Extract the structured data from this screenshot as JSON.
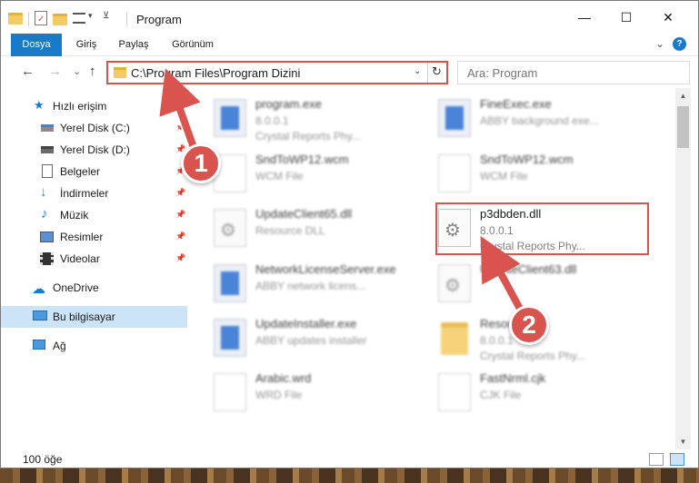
{
  "window": {
    "title": "Program"
  },
  "window_controls": {
    "minimize": "—",
    "maximize": "☐",
    "close": "✕"
  },
  "ribbon": {
    "tabs": [
      "Dosya",
      "Giriş",
      "Paylaş",
      "Görünüm"
    ],
    "expand": "⌄",
    "help": "?"
  },
  "nav": {
    "back": "←",
    "forward": "→",
    "recent": "⌄",
    "up": "↑"
  },
  "address": {
    "path": "C:\\Program Files\\Program Dizini",
    "dropdown": "⌄",
    "refresh": "↻"
  },
  "search": {
    "placeholder": "Ara: Program"
  },
  "sidebar": {
    "quick_access": "Hızlı erişim",
    "items": [
      {
        "label": "Yerel Disk (C:)",
        "icon": "drive-icon",
        "pinned": true
      },
      {
        "label": "Yerel Disk (D:)",
        "icon": "drive-icon",
        "pinned": true
      },
      {
        "label": "Belgeler",
        "icon": "documents-icon",
        "pinned": true
      },
      {
        "label": "İndirmeler",
        "icon": "download-icon",
        "pinned": true
      },
      {
        "label": "Müzik",
        "icon": "music-icon",
        "pinned": true
      },
      {
        "label": "Resimler",
        "icon": "pictures-icon",
        "pinned": true
      },
      {
        "label": "Videolar",
        "icon": "videos-icon",
        "pinned": true
      }
    ],
    "onedrive": "OneDrive",
    "this_pc": "Bu bilgisayar",
    "network": "Ağ",
    "pin_glyph": "📌"
  },
  "files": {
    "col1": [
      {
        "name": "program.exe",
        "line2": "8.0.0.1",
        "line3": "Crystal Reports Phy...",
        "icon": "exe-icon"
      },
      {
        "name": "SndToWP12.wcm",
        "line2": "WCM File",
        "line3": "",
        "icon": "file-icon"
      },
      {
        "name": "UpdateClient65.dll",
        "line2": "Resource DLL",
        "line3": "",
        "icon": "dll-icon"
      },
      {
        "name": "NetworkLicenseServer.exe",
        "line2": "ABBY network licens...",
        "line3": "",
        "icon": "app-icon"
      },
      {
        "name": "UpdateInstaller.exe",
        "line2": "ABBY updates installer",
        "line3": "",
        "icon": "app-icon"
      },
      {
        "name": "Arabic.wrd",
        "line2": "WRD File",
        "line3": "",
        "icon": "file-icon"
      }
    ],
    "col2": [
      {
        "name": "FineExec.exe",
        "line2": "ABBY background exe...",
        "line3": "",
        "icon": "app-icon"
      },
      {
        "name": "SndToWP12.wcm",
        "line2": "WCM File",
        "line3": "",
        "icon": "file-icon"
      },
      {
        "name": "p3dbden.dll",
        "line2": "8.0.0.1",
        "line3": "Crystal Reports Phy...",
        "icon": "dll-icon"
      },
      {
        "name": "UpdateClient63.dll",
        "line2": "",
        "line3": "",
        "icon": "dll-icon"
      },
      {
        "name": "Resou...",
        "line2": "8.0.0.1",
        "line3": "Crystal Reports Phy...",
        "icon": "folder-icon"
      },
      {
        "name": "FastNrml.cjk",
        "line2": "CJK File",
        "line3": "",
        "icon": "file-icon"
      }
    ]
  },
  "status": {
    "count": "100 öğe"
  },
  "annotations": {
    "step1": "1",
    "step2": "2"
  },
  "colors": {
    "accent": "#1979ca",
    "highlight": "#d9534f",
    "selected": "#cce4f7"
  }
}
